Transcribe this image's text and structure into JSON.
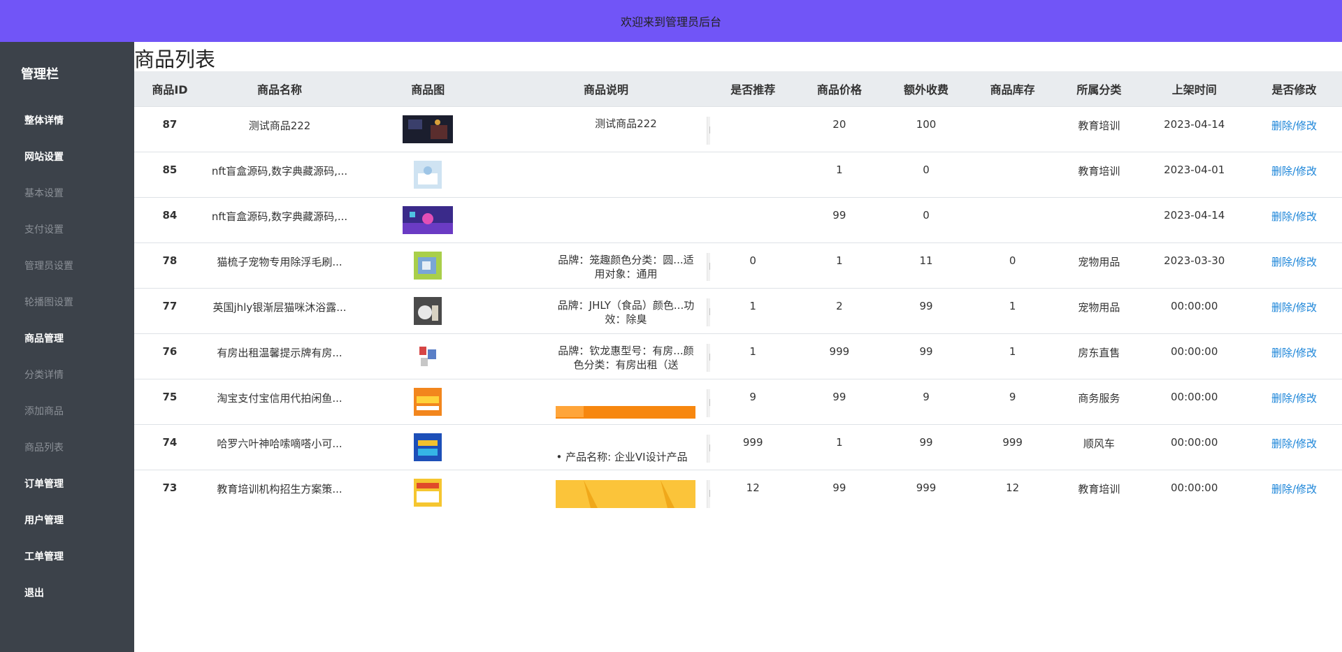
{
  "header": {
    "title": "欢迎来到管理员后台"
  },
  "sidebar": {
    "title": "管理栏",
    "items": [
      {
        "label": "整体详情",
        "strong": true
      },
      {
        "label": "网站设置",
        "strong": true
      },
      {
        "label": "基本设置",
        "strong": false
      },
      {
        "label": "支付设置",
        "strong": false
      },
      {
        "label": "管理员设置",
        "strong": false
      },
      {
        "label": "轮播图设置",
        "strong": false
      },
      {
        "label": "商品管理",
        "strong": true
      },
      {
        "label": "分类详情",
        "strong": false
      },
      {
        "label": "添加商品",
        "strong": false
      },
      {
        "label": "商品列表",
        "strong": false
      },
      {
        "label": "订单管理",
        "strong": true
      },
      {
        "label": "用户管理",
        "strong": true
      },
      {
        "label": "工单管理",
        "strong": true
      },
      {
        "label": "退出",
        "strong": true
      }
    ]
  },
  "main": {
    "title": "商品列表",
    "columns": [
      "商品ID",
      "商品名称",
      "商品图",
      "商品说明",
      "是否推荐",
      "商品价格",
      "额外收费",
      "商品库存",
      "所属分类",
      "上架时间",
      "是否修改"
    ],
    "rows": [
      {
        "id": "87",
        "name": "测试商品222",
        "desc": "测试商品222",
        "recommend": "",
        "price": "20",
        "extra": "100",
        "stock": "",
        "category": "教育培训",
        "time": "2023-04-14",
        "action": "删除/修改"
      },
      {
        "id": "85",
        "name": "nft盲盒源码,数字典藏源码,...",
        "desc": "",
        "recommend": "",
        "price": "1",
        "extra": "0",
        "stock": "",
        "category": "教育培训",
        "time": "2023-04-01",
        "action": "删除/修改"
      },
      {
        "id": "84",
        "name": "nft盲盒源码,数字典藏源码,...",
        "desc": "",
        "recommend": "",
        "price": "99",
        "extra": "0",
        "stock": "",
        "category": "",
        "time": "2023-04-14",
        "action": "删除/修改"
      },
      {
        "id": "78",
        "name": "猫梳子宠物专用除浮毛刷...",
        "desc": "品牌：笼趣颜色分类：圆...适用对象：通用",
        "recommend": "0",
        "price": "1",
        "extra": "11",
        "stock": "0",
        "category": "宠物用品",
        "time": "2023-03-30",
        "action": "删除/修改"
      },
      {
        "id": "77",
        "name": "英国jhly银渐层猫咪沐浴露...",
        "desc": "品牌：JHLY（食品）颜色...功效：除臭",
        "recommend": "1",
        "price": "2",
        "extra": "99",
        "stock": "1",
        "category": "宠物用品",
        "time": "00:00:00",
        "action": "删除/修改"
      },
      {
        "id": "76",
        "name": "有房出租温馨提示牌有房...",
        "desc": "品牌：钦龙惠型号：有房...颜色分类：有房出租（送",
        "recommend": "1",
        "price": "999",
        "extra": "99",
        "stock": "1",
        "category": "房东直售",
        "time": "00:00:00",
        "action": "删除/修改"
      },
      {
        "id": "75",
        "name": "淘宝支付宝信用代拍闲鱼...",
        "desc": "",
        "recommend": "9",
        "price": "99",
        "extra": "9",
        "stock": "9",
        "category": "商务服务",
        "time": "00:00:00",
        "action": "删除/修改"
      },
      {
        "id": "74",
        "name": "哈罗六叶神哈嗦嘀嗒小可...",
        "desc": "产品名称: 企业VI设计产品",
        "recommend": "999",
        "price": "1",
        "extra": "99",
        "stock": "999",
        "category": "顺风车",
        "time": "00:00:00",
        "action": "删除/修改"
      },
      {
        "id": "73",
        "name": "教育培训机构招生方案策...",
        "desc": "",
        "recommend": "12",
        "price": "99",
        "extra": "999",
        "stock": "12",
        "category": "教育培训",
        "time": "00:00:00",
        "action": "删除/修改"
      }
    ]
  },
  "icons": {
    "scroll_up": "scroll-up-arrow-icon",
    "scroll_down": "scroll-down-arrow-icon"
  },
  "colors": {
    "header_bg": "#7155f7",
    "sidebar_bg": "#3c424a",
    "link": "#1a84d8",
    "table_head_bg": "#e9ecef"
  }
}
